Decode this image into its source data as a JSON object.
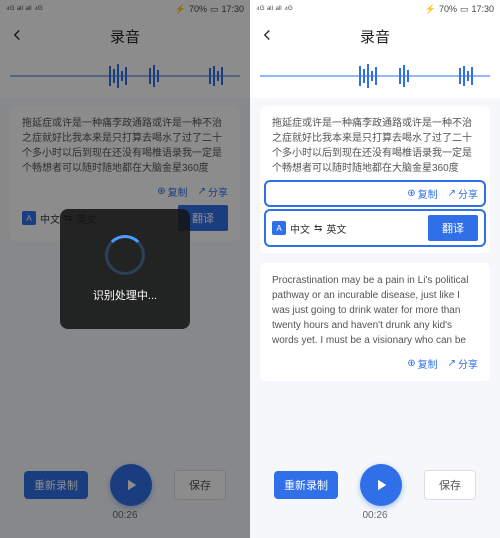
{
  "status": {
    "signal": "⁴ᴳ ᵃˡˡ ᵃˡˡ ⁴ᴳ",
    "battery": "70%",
    "time": "17:30",
    "bticon": "⚡"
  },
  "header": {
    "title": "录音"
  },
  "source_text": "拖延症或许是一种痛李政通路或许是一种不治之症就好比我本来是只打算去喝水了过了二十个多小时以后到现在还没有喝椎语录我一定是个畅想者可以随时随地都在大脑金星360度",
  "actions": {
    "copy": "复制",
    "share": "分享"
  },
  "lang": {
    "from": "中文",
    "to": "英文",
    "btn": "翻译"
  },
  "translation_text": "Procrastination may be a pain in Li's political pathway or an incurable disease, just like I was just going to drink water for more than twenty hours and haven't drunk any kid's words yet. I must be a visionary who can be",
  "modal": {
    "text": "识别处理中..."
  },
  "controls": {
    "rerec": "重新录制",
    "save": "保存",
    "time": "00:26"
  }
}
